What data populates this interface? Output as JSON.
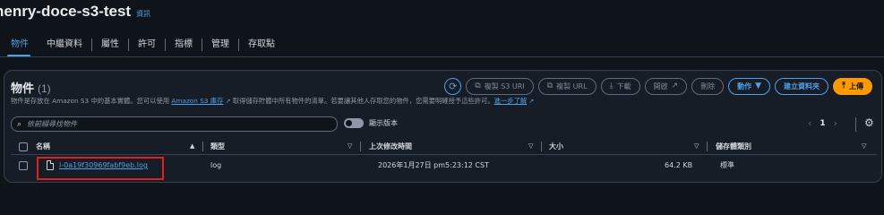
{
  "bucket": {
    "name": "henry-doce-s3-test",
    "info": "資訊"
  },
  "tabs": [
    "物件",
    "中繼資料",
    "屬性",
    "許可",
    "指標",
    "管理",
    "存取點"
  ],
  "objects_panel": {
    "title": "物件",
    "count": "(1)",
    "description_prefix": "物件是存放在 Amazon S3 中的基本實體。您可以使用 ",
    "inventory_link": "Amazon S3 庫存",
    "description_middle": " 取得儲存貯體中所有物件的清單。若要讓其他人存取您的物件，您需要明確授予這些許可。",
    "learn_more": "進一步了解"
  },
  "actions": {
    "copy_s3_uri": "複製 S3 URI",
    "copy_url": "複製 URL",
    "download": "下載",
    "open": "開啟",
    "delete": "刪除",
    "actions_menu": "動作",
    "create_folder": "建立資料夾",
    "upload": "上傳"
  },
  "search": {
    "placeholder": "依前綴尋找物件",
    "value": ""
  },
  "show_versions": {
    "label": "顯示版本",
    "enabled": false
  },
  "pagination": {
    "current_page": "1"
  },
  "table": {
    "headers": {
      "name": "名稱",
      "type": "類型",
      "last_modified": "上次修改時間",
      "size": "大小",
      "storage_class": "儲存體類別"
    },
    "rows": [
      {
        "name": "i-0a19f30969fabf9eb.log",
        "type": "log",
        "last_modified": "2026年1月27日 pm5:23:12 CST",
        "size": "64.2 KB",
        "storage_class": "標準"
      }
    ]
  },
  "colors": {
    "accent": "#539fe5",
    "primary_button": "#ff9900",
    "background": "#0f141a",
    "highlight_box": "#e0201c"
  },
  "icons": [
    "refresh-icon",
    "copy-icon",
    "download-icon",
    "external-link-icon",
    "caret-down-icon",
    "upload-icon",
    "search-icon",
    "settings-icon",
    "file-icon",
    "sort-icon"
  ]
}
